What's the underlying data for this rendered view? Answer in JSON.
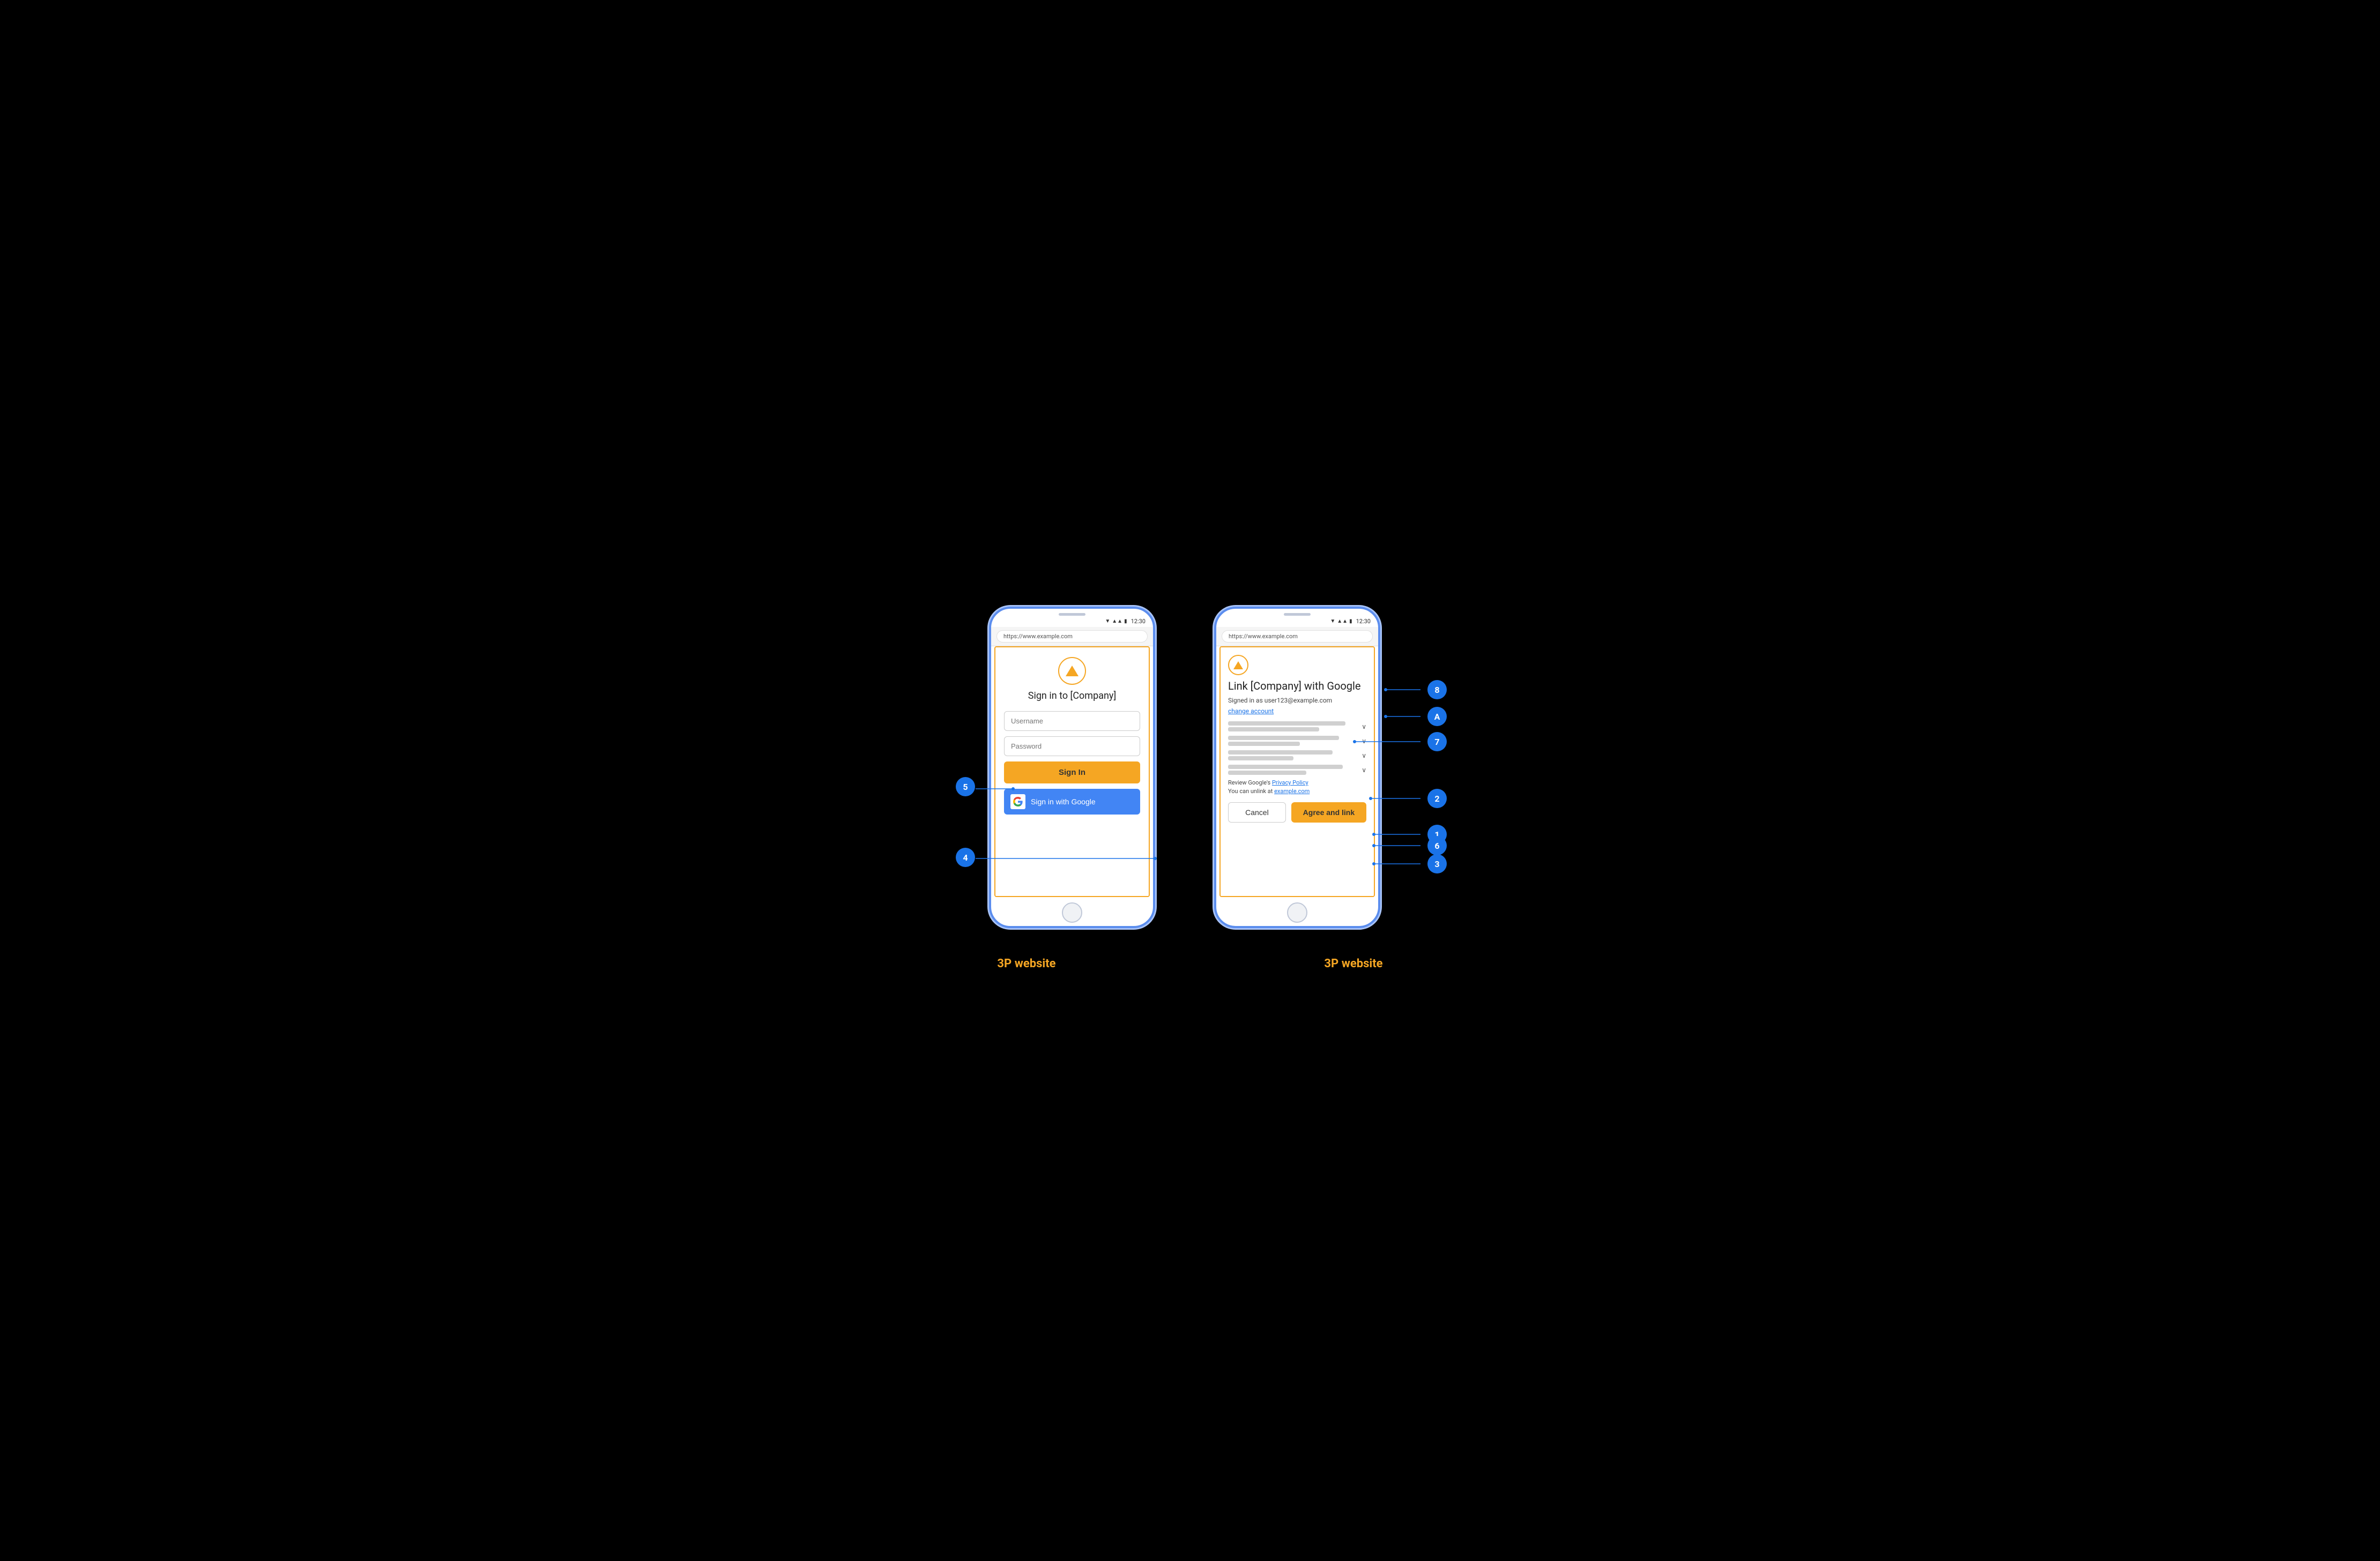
{
  "diagram": {
    "background": "#000000",
    "phones": [
      {
        "id": "left-phone",
        "label": "3P website",
        "status_time": "12:30",
        "url": "https://www.example.com",
        "screen": {
          "type": "sign-in",
          "title": "Sign in to [Company]",
          "username_placeholder": "Username",
          "password_placeholder": "Password",
          "sign_in_btn": "Sign In",
          "google_btn": "Sign in with Google"
        }
      },
      {
        "id": "right-phone",
        "label": "3P website",
        "status_time": "12:30",
        "url": "https://www.example.com",
        "screen": {
          "type": "link",
          "title": "Link [Company] with Google",
          "signed_in_as": "Signed in as user123@example.com",
          "change_account": "change account",
          "policy_text": "Review Google's",
          "privacy_policy_link": "Privacy Policy",
          "unlink_text": "You can unlink at",
          "unlink_link": "example.com",
          "cancel_btn": "Cancel",
          "agree_btn": "Agree and link"
        }
      }
    ],
    "annotations": [
      {
        "id": "1",
        "label": "1"
      },
      {
        "id": "2",
        "label": "2"
      },
      {
        "id": "3",
        "label": "3"
      },
      {
        "id": "4",
        "label": "4"
      },
      {
        "id": "5",
        "label": "5"
      },
      {
        "id": "6",
        "label": "6"
      },
      {
        "id": "7",
        "label": "7"
      },
      {
        "id": "8",
        "label": "8"
      },
      {
        "id": "A",
        "label": "A"
      }
    ]
  }
}
